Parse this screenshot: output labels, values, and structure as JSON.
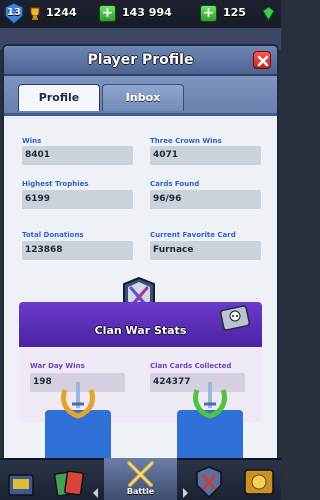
{
  "topbar": {
    "level": "13",
    "trophies": "1244",
    "gold": "143 994",
    "gems": "125"
  },
  "modal": {
    "title": "Player Profile",
    "tabs": [
      "Profile",
      "Inbox"
    ]
  },
  "stats": [
    {
      "label": "Wins",
      "value": "8401"
    },
    {
      "label": "Three Crown Wins",
      "value": "4071"
    },
    {
      "label": "Highest Trophies",
      "value": "6199"
    },
    {
      "label": "Cards Found",
      "value": "96/96"
    },
    {
      "label": "Total Donations",
      "value": "123868"
    },
    {
      "label": "Current Favorite Card",
      "value": "Furnace"
    }
  ],
  "clan_war": {
    "title": "Clan War Stats",
    "items": [
      {
        "label": "War Day Wins",
        "value": "198"
      },
      {
        "label": "Clan Cards Collected",
        "value": "424377"
      }
    ]
  },
  "navbar": {
    "battle": "Battle"
  },
  "colors": {
    "header": "#5d76a6",
    "stat_label": "#2d63c7",
    "clan_banner": "#5a2eb6",
    "close": "#e0342a"
  }
}
